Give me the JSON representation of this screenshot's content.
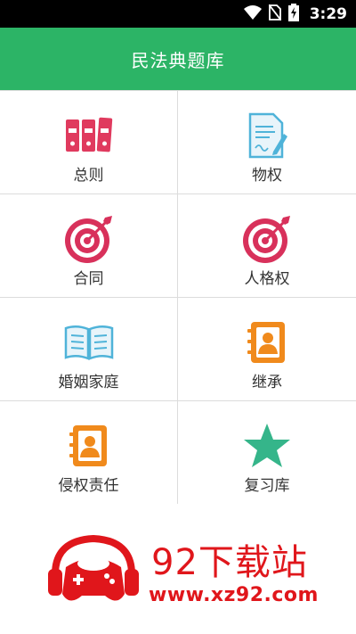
{
  "status_bar": {
    "time": "3:29",
    "icons": [
      "wifi-icon",
      "no-sim-icon",
      "battery-charging-icon"
    ]
  },
  "app_bar": {
    "title": "民法典题库",
    "color": "#2cb466"
  },
  "menu": [
    {
      "label": "总则",
      "icon": "binders-icon",
      "color": "#e03a5e"
    },
    {
      "label": "物权",
      "icon": "document-pen-icon",
      "color": "#4fb3d9"
    },
    {
      "label": "合同",
      "icon": "target-icon",
      "color": "#d8315b"
    },
    {
      "label": "人格权",
      "icon": "target-icon",
      "color": "#d8315b"
    },
    {
      "label": "婚姻家庭",
      "icon": "open-book-icon",
      "color": "#4fb3d9"
    },
    {
      "label": "继承",
      "icon": "contact-book-icon",
      "color": "#f08a1c"
    },
    {
      "label": "侵权责任",
      "icon": "contact-book-icon",
      "color": "#f08a1c"
    },
    {
      "label": "复习库",
      "icon": "star-icon",
      "color": "#35b58a"
    }
  ],
  "watermark": {
    "title": "92下载站",
    "url": "www.xz92.com",
    "color": "#e0161b"
  }
}
